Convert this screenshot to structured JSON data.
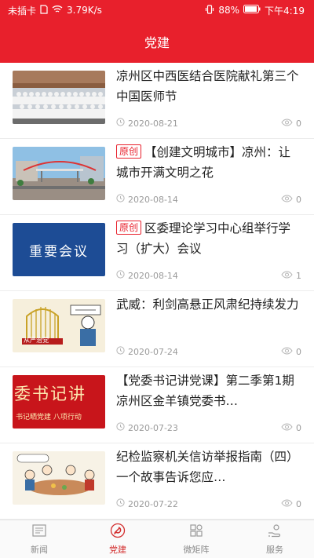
{
  "status_bar": {
    "carrier": "未插卡",
    "speed": "3.79K/s",
    "battery": "88%",
    "time": "下午4:19"
  },
  "header": {
    "title": "党建"
  },
  "articles": [
    {
      "title": "凉州区中西医结合医院献礼第三个中国医师节",
      "tag": "",
      "date": "2020-08-21",
      "views": "0",
      "thumb": "group-photo"
    },
    {
      "title": "【创建文明城市】凉州：让城市开满文明之花",
      "tag": "原创",
      "date": "2020-08-14",
      "views": "0",
      "thumb": "city-street"
    },
    {
      "title": "区委理论学习中心组举行学习（扩大）会议",
      "tag": "原创",
      "date": "2020-08-14",
      "views": "1",
      "thumb": "meeting-banner",
      "thumb_text": "重要会议"
    },
    {
      "title": "武威：利剑高悬正风肃纪持续发力",
      "tag": "",
      "date": "2020-07-24",
      "views": "0",
      "thumb": "cartoon-cage",
      "thumb_text": "从严治党"
    },
    {
      "title": "【党委书记讲党课】第二季第1期凉州区金羊镇党委书…",
      "tag": "",
      "date": "2020-07-23",
      "views": "0",
      "thumb": "red-banner",
      "thumb_text": "委书记讲",
      "thumb_subtext": "书记晒党建  八项行动"
    },
    {
      "title": "纪检监察机关信访举报指南（四） 一个故事告诉您应…",
      "tag": "",
      "date": "2020-07-22",
      "views": "0",
      "thumb": "cartoon-dinner"
    }
  ],
  "tabs": [
    {
      "label": "新闻",
      "icon": "newspaper-icon",
      "active": false
    },
    {
      "label": "党建",
      "icon": "party-emblem-icon",
      "active": true
    },
    {
      "label": "微矩阵",
      "icon": "grid-icon",
      "active": false
    },
    {
      "label": "服务",
      "icon": "hand-service-icon",
      "active": false
    }
  ],
  "colors": {
    "brand_red": "#e8202c",
    "active_tab": "#d32f2f",
    "meta_gray": "#9a9a9a"
  }
}
